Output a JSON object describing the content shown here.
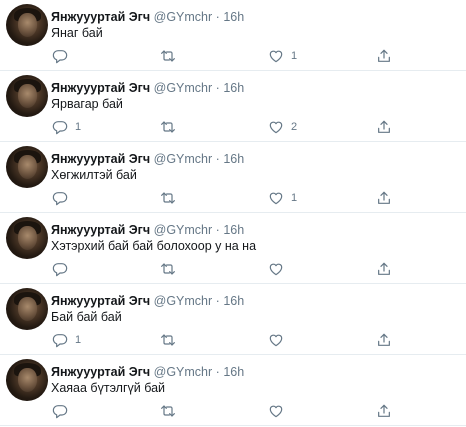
{
  "tweets": [
    {
      "name": "Янжуууртай Эгч",
      "handle": "@GYmchr",
      "time": "16h",
      "text": "Янаг бай",
      "replies": "",
      "retweets": "",
      "likes": "1"
    },
    {
      "name": "Янжуууртай Эгч",
      "handle": "@GYmchr",
      "time": "16h",
      "text": "Ярвагар бай",
      "replies": "1",
      "retweets": "",
      "likes": "2"
    },
    {
      "name": "Янжуууртай Эгч",
      "handle": "@GYmchr",
      "time": "16h",
      "text": "Хөгжилтэй бай",
      "replies": "",
      "retweets": "",
      "likes": "1"
    },
    {
      "name": "Янжуууртай Эгч",
      "handle": "@GYmchr",
      "time": "16h",
      "text": "Хэтэрхий бай бай болохоор у на на",
      "replies": "",
      "retweets": "",
      "likes": ""
    },
    {
      "name": "Янжуууртай Эгч",
      "handle": "@GYmchr",
      "time": "16h",
      "text": "Бай бай бай",
      "replies": "1",
      "retweets": "",
      "likes": ""
    },
    {
      "name": "Янжуууртай Эгч",
      "handle": "@GYmchr",
      "time": "16h",
      "text": "Хаяаа бүтэлгүй бай",
      "replies": "",
      "retweets": "",
      "likes": ""
    }
  ],
  "separator": "·",
  "icons": {
    "reply": "reply-icon",
    "retweet": "retweet-icon",
    "like": "heart-icon",
    "share": "share-icon"
  },
  "colors": {
    "text": "#14171a",
    "muted": "#657786",
    "border": "#e6ecf0"
  }
}
